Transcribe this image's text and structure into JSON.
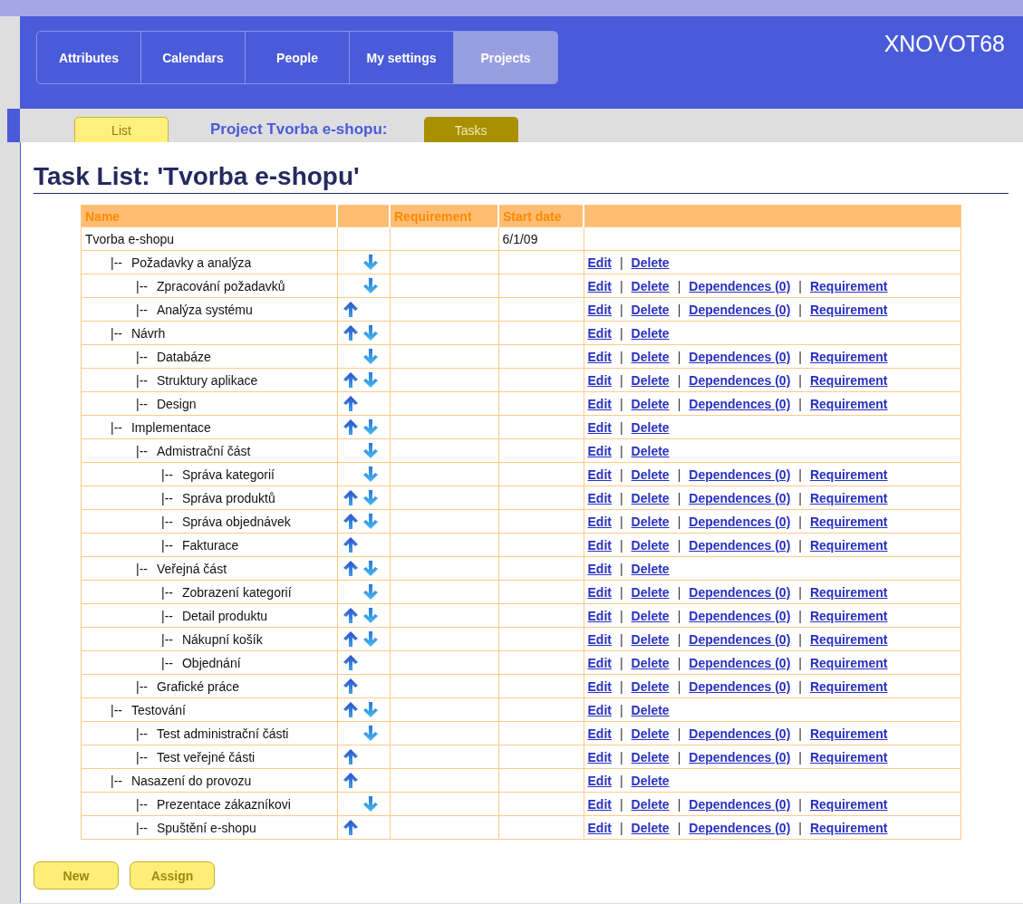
{
  "header": {
    "tabs": [
      {
        "label": "Attributes",
        "selected": false
      },
      {
        "label": "Calendars",
        "selected": false
      },
      {
        "label": "People",
        "selected": false
      },
      {
        "label": "My settings",
        "selected": false
      },
      {
        "label": "Projects",
        "selected": true
      }
    ],
    "user": "XNOVOT68"
  },
  "subnav": {
    "tabs": [
      {
        "label": "List",
        "selected": false
      },
      {
        "label": "Tasks",
        "selected": true
      }
    ],
    "project_label": "Project Tvorba e-shopu:"
  },
  "title": "Task List: 'Tvorba e-shopu'",
  "table": {
    "columns": {
      "name": "Name",
      "requirement": "Requirement",
      "start_date": "Start date"
    },
    "link_separator": "|",
    "rows": [
      {
        "name": "Tvorba e-shopu",
        "start_date": "6/1/09",
        "up": false,
        "down": false,
        "children": [
          {
            "branch": "|--",
            "name": "Požadavky a analýza",
            "up": false,
            "down": true,
            "actions": [
              "Edit",
              "Delete"
            ],
            "children": [
              {
                "branch": "|--",
                "name": "Zpracování požadavků",
                "up": false,
                "down": true,
                "actions": [
                  "Edit",
                  "Delete",
                  "Dependences (0)",
                  "Requirement"
                ]
              },
              {
                "branch": "|--",
                "name": "Analýza systému",
                "up": true,
                "down": false,
                "actions": [
                  "Edit",
                  "Delete",
                  "Dependences (0)",
                  "Requirement"
                ]
              }
            ]
          },
          {
            "branch": "|--",
            "name": "Návrh",
            "up": true,
            "down": true,
            "actions": [
              "Edit",
              "Delete"
            ],
            "children": [
              {
                "branch": "|--",
                "name": "Databáze",
                "up": false,
                "down": true,
                "actions": [
                  "Edit",
                  "Delete",
                  "Dependences (0)",
                  "Requirement"
                ]
              },
              {
                "branch": "|--",
                "name": "Struktury aplikace",
                "up": true,
                "down": true,
                "actions": [
                  "Edit",
                  "Delete",
                  "Dependences (0)",
                  "Requirement"
                ]
              },
              {
                "branch": "|--",
                "name": "Design",
                "up": true,
                "down": false,
                "actions": [
                  "Edit",
                  "Delete",
                  "Dependences (0)",
                  "Requirement"
                ]
              }
            ]
          },
          {
            "branch": "|--",
            "name": "Implementace",
            "up": true,
            "down": true,
            "actions": [
              "Edit",
              "Delete"
            ],
            "children": [
              {
                "branch": "|--",
                "name": "Admistrační část",
                "up": false,
                "down": true,
                "actions": [
                  "Edit",
                  "Delete"
                ],
                "children": [
                  {
                    "branch": "|--",
                    "name": "Správa kategorií",
                    "up": false,
                    "down": true,
                    "actions": [
                      "Edit",
                      "Delete",
                      "Dependences (0)",
                      "Requirement"
                    ]
                  },
                  {
                    "branch": "|--",
                    "name": "Správa produktů",
                    "up": true,
                    "down": true,
                    "actions": [
                      "Edit",
                      "Delete",
                      "Dependences (0)",
                      "Requirement"
                    ]
                  },
                  {
                    "branch": "|--",
                    "name": "Správa objednávek",
                    "up": true,
                    "down": true,
                    "actions": [
                      "Edit",
                      "Delete",
                      "Dependences (0)",
                      "Requirement"
                    ]
                  },
                  {
                    "branch": "|--",
                    "name": "Fakturace",
                    "up": true,
                    "down": false,
                    "actions": [
                      "Edit",
                      "Delete",
                      "Dependences (0)",
                      "Requirement"
                    ]
                  }
                ]
              },
              {
                "branch": "|--",
                "name": "Veřejná část",
                "up": true,
                "down": true,
                "actions": [
                  "Edit",
                  "Delete"
                ],
                "children": [
                  {
                    "branch": "|--",
                    "name": "Zobrazení kategorií",
                    "up": false,
                    "down": true,
                    "actions": [
                      "Edit",
                      "Delete",
                      "Dependences (0)",
                      "Requirement"
                    ]
                  },
                  {
                    "branch": "|--",
                    "name": "Detail produktu",
                    "up": true,
                    "down": true,
                    "actions": [
                      "Edit",
                      "Delete",
                      "Dependences (0)",
                      "Requirement"
                    ]
                  },
                  {
                    "branch": "|--",
                    "name": "Nákupní košík",
                    "up": true,
                    "down": true,
                    "actions": [
                      "Edit",
                      "Delete",
                      "Dependences (0)",
                      "Requirement"
                    ]
                  },
                  {
                    "branch": "|--",
                    "name": "Objednání",
                    "up": true,
                    "down": false,
                    "actions": [
                      "Edit",
                      "Delete",
                      "Dependences (0)",
                      "Requirement"
                    ]
                  }
                ]
              },
              {
                "branch": "|--",
                "name": "Grafické práce",
                "up": true,
                "down": false,
                "actions": [
                  "Edit",
                  "Delete",
                  "Dependences (0)",
                  "Requirement"
                ]
              }
            ]
          },
          {
            "branch": "|--",
            "name": "Testování",
            "up": true,
            "down": true,
            "actions": [
              "Edit",
              "Delete"
            ],
            "children": [
              {
                "branch": "|--",
                "name": "Test administrační části",
                "up": false,
                "down": true,
                "actions": [
                  "Edit",
                  "Delete",
                  "Dependences (0)",
                  "Requirement"
                ]
              },
              {
                "branch": "|--",
                "name": "Test veřejné části",
                "up": true,
                "down": false,
                "actions": [
                  "Edit",
                  "Delete",
                  "Dependences (0)",
                  "Requirement"
                ]
              }
            ]
          },
          {
            "branch": "|--",
            "name": "Nasazení do provozu",
            "up": true,
            "down": false,
            "actions": [
              "Edit",
              "Delete"
            ],
            "children": [
              {
                "branch": "|--",
                "name": "Prezentace zákazníkovi",
                "up": false,
                "down": true,
                "actions": [
                  "Edit",
                  "Delete",
                  "Dependences (0)",
                  "Requirement"
                ]
              },
              {
                "branch": "|--",
                "name": "Spuštění e-shopu",
                "up": true,
                "down": false,
                "actions": [
                  "Edit",
                  "Delete",
                  "Dependences (0)",
                  "Requirement"
                ]
              }
            ]
          }
        ]
      }
    ]
  },
  "buttons": [
    "New",
    "Assign"
  ]
}
